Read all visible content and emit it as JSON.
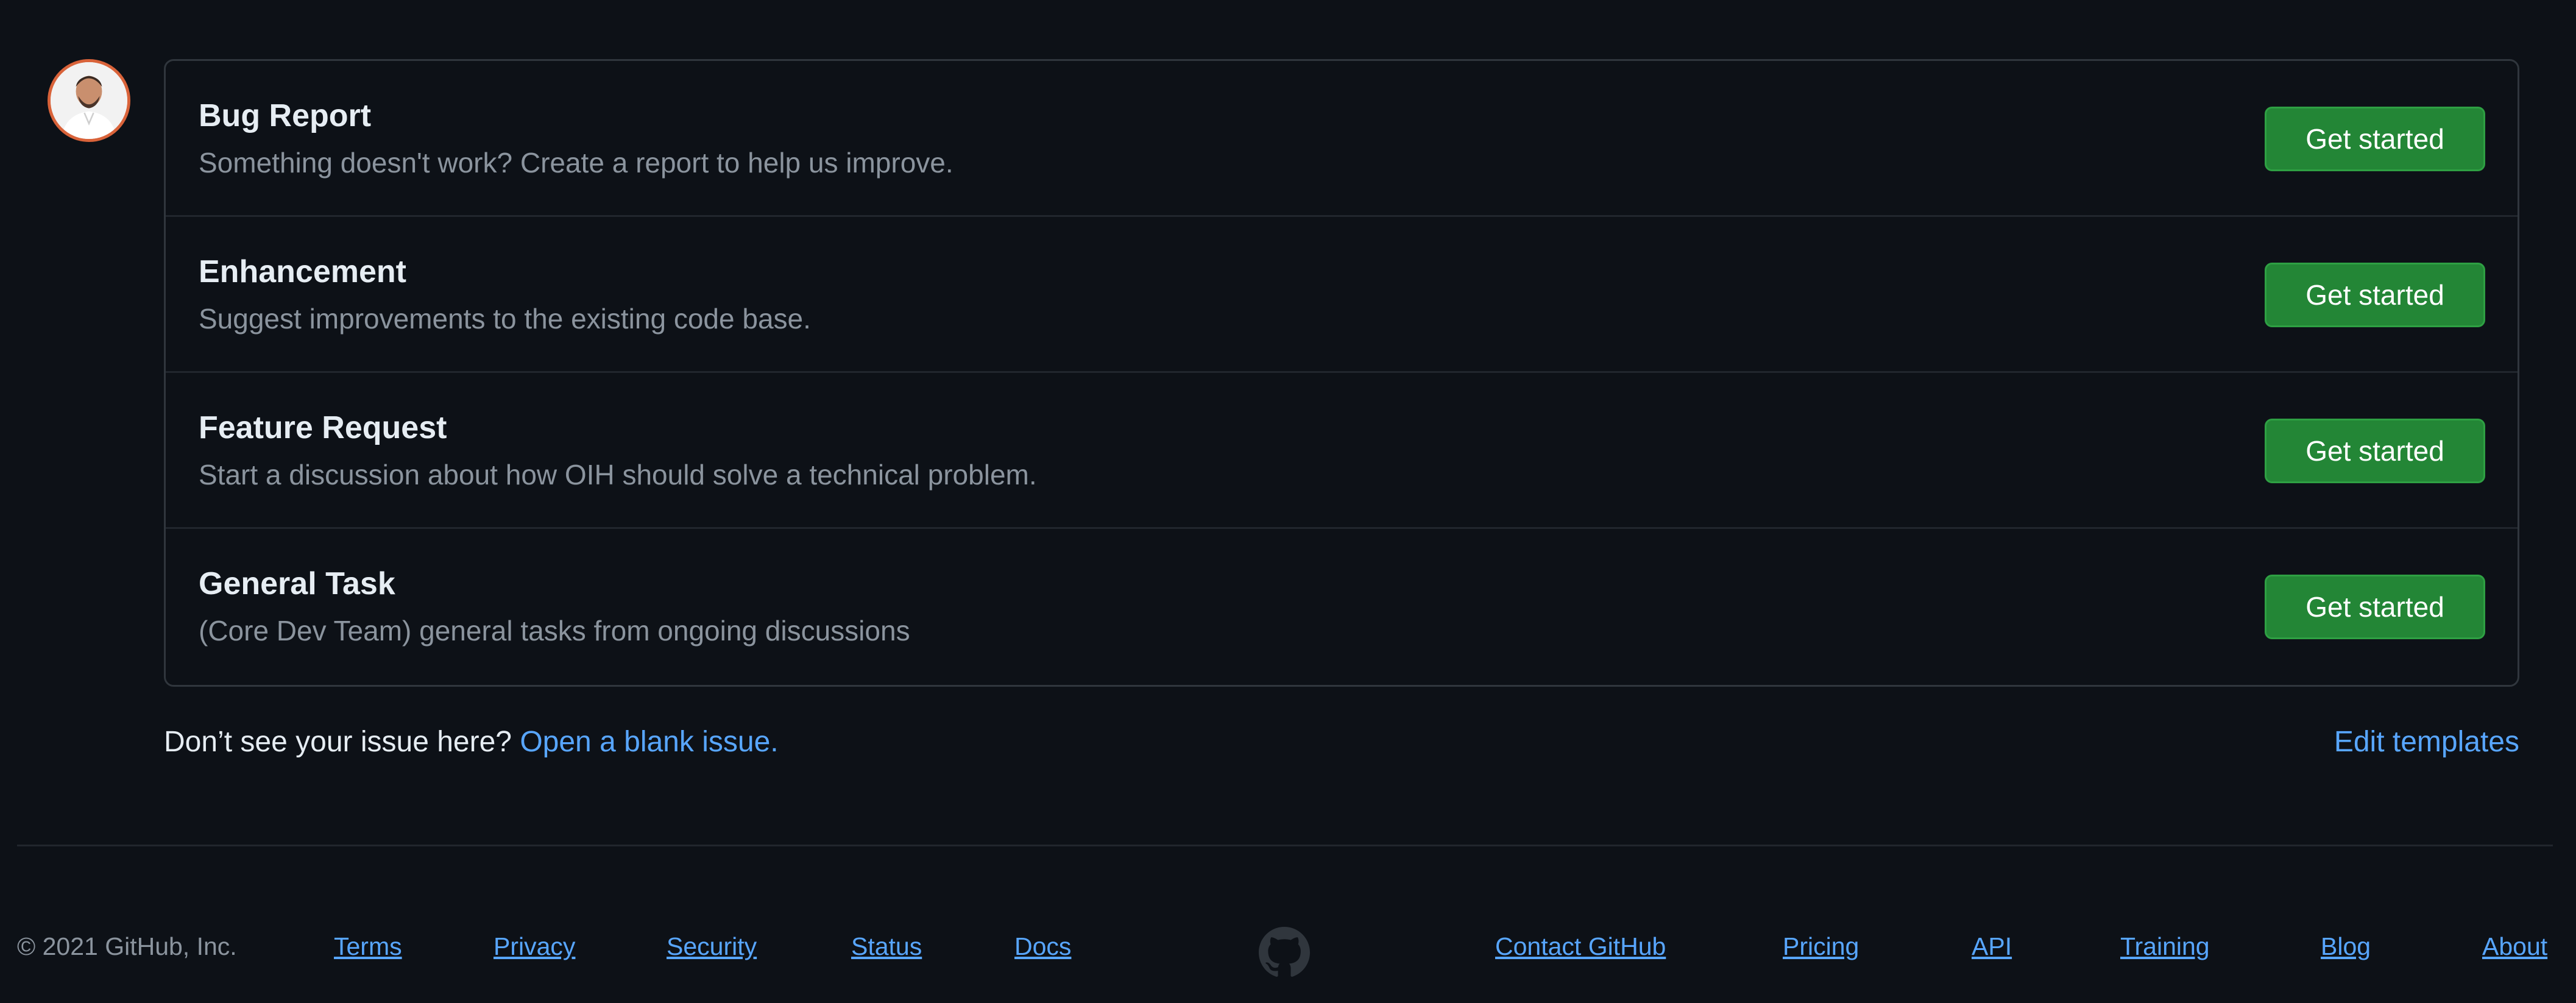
{
  "templates": [
    {
      "title": "Bug Report",
      "description": "Something doesn't work? Create a report to help us improve.",
      "button": "Get started"
    },
    {
      "title": "Enhancement",
      "description": "Suggest improvements to the existing code base.",
      "button": "Get started"
    },
    {
      "title": "Feature Request",
      "description": "Start a discussion about how OIH should solve a technical problem.",
      "button": "Get started"
    },
    {
      "title": "General Task",
      "description": "(Core Dev Team) general tasks from ongoing discussions",
      "button": "Get started"
    }
  ],
  "blank_issue": {
    "prompt": "Don’t see your issue here?",
    "link": "Open a blank issue."
  },
  "edit_templates": "Edit templates",
  "footer": {
    "copyright": "© 2021 GitHub, Inc.",
    "left_links": [
      "Terms",
      "Privacy",
      "Security",
      "Status",
      "Docs"
    ],
    "right_links": [
      "Contact GitHub",
      "Pricing",
      "API",
      "Training",
      "Blog",
      "About"
    ],
    "logo_icon": "github-octocat-icon"
  },
  "colors": {
    "background": "#0d1117",
    "button_green": "#238636",
    "link_blue": "#58a6ff"
  },
  "avatar_icon": "user-avatar-icon"
}
